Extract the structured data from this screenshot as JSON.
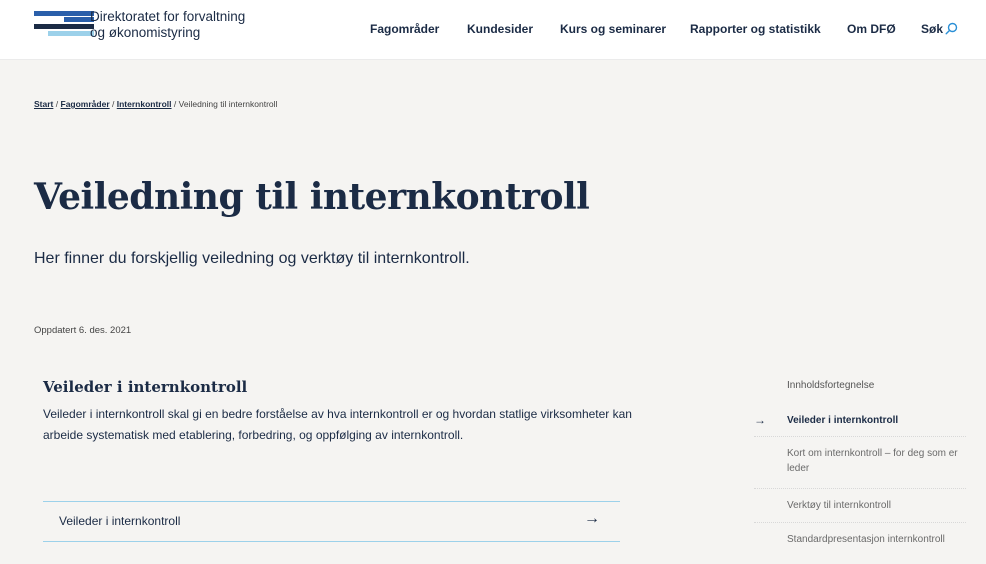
{
  "header": {
    "logo_line1": "Direktoratet for forvaltning",
    "logo_line2": "og økonomistyring",
    "nav": [
      "Fagområder",
      "Kundesider",
      "Kurs og seminarer",
      "Rapporter og statistikk",
      "Om DFØ"
    ],
    "search_label": "Søk",
    "colors": {
      "dark": "#1b2b45",
      "light_blue": "#9cd1ea",
      "mid_blue": "#2a5faa"
    }
  },
  "breadcrumb": {
    "items": [
      "Start",
      "Fagområder",
      "Internkontroll"
    ],
    "current": "Veiledning til internkontroll",
    "separator": "/"
  },
  "page": {
    "title": "Veiledning til internkontroll",
    "lead": "Her finner du forskjellig veiledning og verktøy til internkontroll.",
    "updated": "Oppdatert 6. des. 2021"
  },
  "section": {
    "title": "Veileder i internkontroll",
    "body": "Veileder i internkontroll skal gi en bedre forståelse av hva internkontroll er og hvordan statlige virksomheter kan arbeide systematisk med etablering, forbedring, og oppfølging av internkontroll.",
    "link_label": "Veileder i internkontroll",
    "link_arrow": "→"
  },
  "toc": {
    "heading": "Innholdsfortegnelse",
    "active_arrow": "→",
    "items": [
      "Veileder i internkontroll",
      "Kort om internkontroll – for deg som er leder",
      "Verktøy til internkontroll",
      "Standardpresentasjon internkontroll"
    ]
  }
}
